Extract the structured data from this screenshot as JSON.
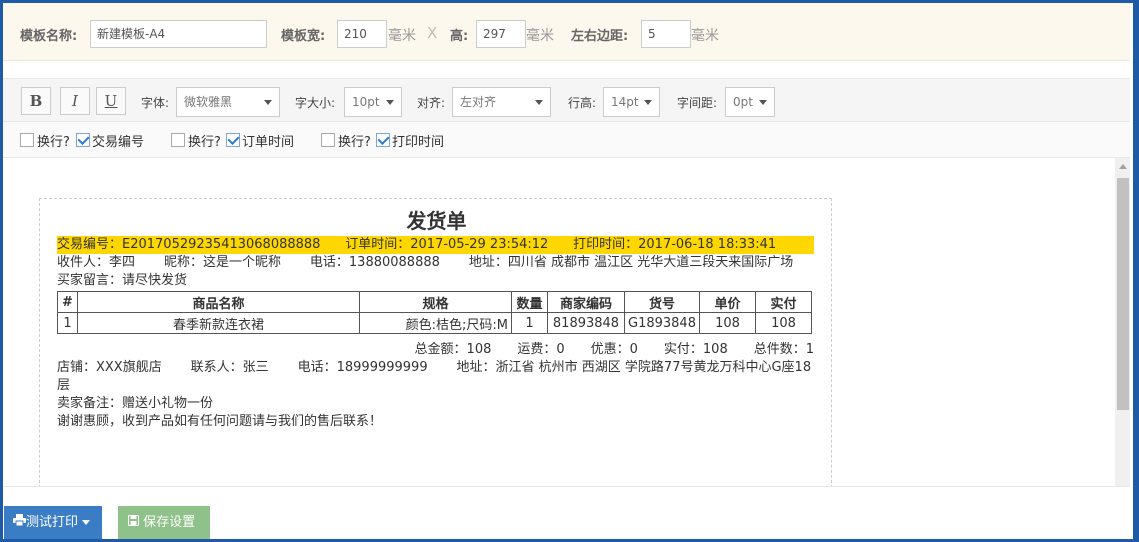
{
  "template": {
    "name_label": "模板名称:",
    "name_value": "新建模板-A4",
    "width_label": "模板宽:",
    "width_value": "210",
    "unit": "毫米",
    "times": "X",
    "height_label": "高:",
    "height_value": "297",
    "margin_label": "左右边距:",
    "margin_value": "5"
  },
  "format": {
    "bold": "B",
    "italic": "I",
    "underline": "U",
    "font_label": "字体:",
    "font_value": "微软雅黑",
    "size_label": "字大小:",
    "size_value": "10pt",
    "align_label": "对齐:",
    "align_value": "左对齐",
    "lineheight_label": "行高:",
    "lineheight_value": "14pt",
    "spacing_label": "字间距:",
    "spacing_value": "0pt"
  },
  "fields": [
    {
      "wrap_label": "换行?",
      "wrap_checked": false,
      "field_label": "交易编号",
      "field_checked": true
    },
    {
      "wrap_label": "换行?",
      "wrap_checked": false,
      "field_label": "订单时间",
      "field_checked": true
    },
    {
      "wrap_label": "换行?",
      "wrap_checked": false,
      "field_label": "打印时间",
      "field_checked": true
    }
  ],
  "preview": {
    "title": "发货单",
    "trade_no": "交易编号：E20170529235413068088888",
    "order_time": "订单时间：2017-05-29 23:54:12",
    "print_time": "打印时间：2017-06-18 18:33:41",
    "receiver": "收件人：李四",
    "nickname": "昵称：这是一个昵称",
    "phone": "电话：13880088888",
    "address": "地址：四川省 成都市 温江区 光华大道三段天来国际广场",
    "buyer_msg": "买家留言：请尽快发货",
    "table_headers": [
      "#",
      "商品名称",
      "规格",
      "数量",
      "商家编码",
      "货号",
      "单价",
      "实付"
    ],
    "table_rows": [
      [
        "1",
        "春季新款连衣裙",
        "颜色:桔色;尺码:M",
        "1",
        "81893848",
        "G1893848",
        "108",
        "108"
      ]
    ],
    "totals": "总金额：108　　运费：0　　优惠：0　　实付：108　　总件数：1",
    "shop": "店铺：XXX旗舰店",
    "contact": "联系人：张三",
    "shop_phone": "电话：18999999999",
    "shop_address": "地址：浙江省 杭州市 西湖区 学院路77号黄龙万科中心G座18",
    "shop_address_wrap": "层",
    "seller_note": "卖家备注：赠送小礼物一份",
    "thanks": "谢谢惠顾，收到产品如有任何问题请与我们的售后联系！"
  },
  "buttons": {
    "test_print": "测试打印",
    "save": "保存设置"
  },
  "colors": {
    "highlight": "#ffd700",
    "print_button": "#3b7dc4",
    "save_button": "#8fc28a",
    "frame": "#1e5aa6"
  }
}
